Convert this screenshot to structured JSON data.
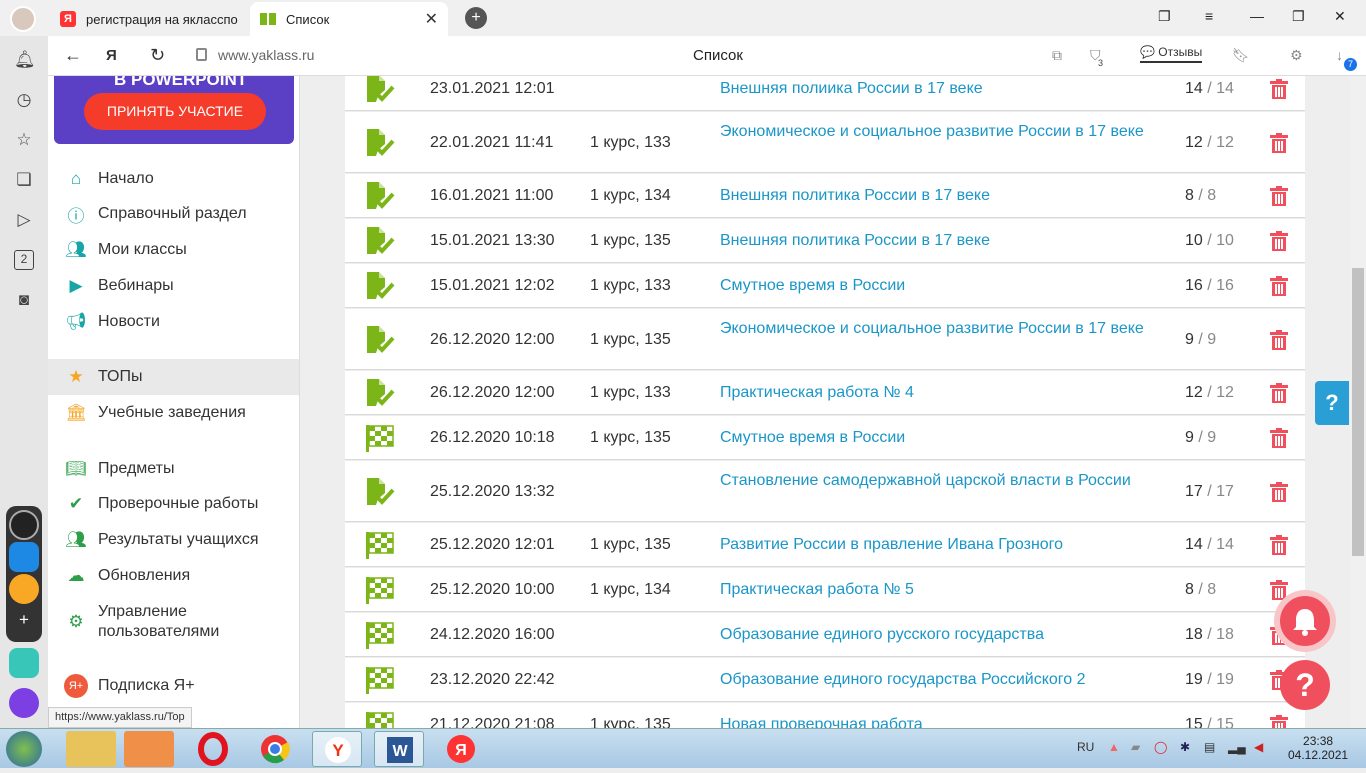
{
  "browser": {
    "tabs": [
      {
        "label": "регистрация на якласспо",
        "favicon": "Я"
      },
      {
        "label": "Список",
        "favicon": "yaklass-icon"
      }
    ],
    "url": "www.yaklass.ru",
    "page_title": "Список",
    "reviews_label": "Отзывы",
    "badge_count": "3",
    "downloads_count": "7",
    "status_url": "https://www.yaklass.ru/Top"
  },
  "sidebar": {
    "promo_title": "В POWERPOINT",
    "promo_button": "ПРИНЯТЬ УЧАСТИЕ",
    "menu": [
      {
        "label": "Начало",
        "icon": "home-icon"
      },
      {
        "label": "Справочный раздел",
        "icon": "help-icon"
      },
      {
        "label": "Мои классы",
        "icon": "people-icon"
      },
      {
        "label": "Вебинары",
        "icon": "play-icon"
      },
      {
        "label": "Новости",
        "icon": "megaphone-icon"
      },
      {
        "label": "ТОПы",
        "icon": "star-icon"
      },
      {
        "label": "Учебные заведения",
        "icon": "institution-icon"
      },
      {
        "label": "Предметы",
        "icon": "book-icon"
      },
      {
        "label": "Проверочные работы",
        "icon": "check-circle-icon"
      },
      {
        "label": "Результаты учащихся",
        "icon": "users-icon"
      },
      {
        "label": "Обновления",
        "icon": "cloud-icon"
      },
      {
        "label": "Управление пользователями",
        "icon": "gear-users-icon"
      },
      {
        "label": "Подписка Я+",
        "icon": "subscription-icon"
      }
    ]
  },
  "rows": [
    {
      "icon": "doc-check",
      "date": "23.01.2021 12:01",
      "class": "",
      "title": "Внешняя полиика России в 17 веке",
      "score": "14",
      "total": "/ 14"
    },
    {
      "icon": "doc-check",
      "date": "22.01.2021 11:41",
      "class": "1 курс, 133",
      "title": "Экономическое и социальное развитие России в 17 веке",
      "score": "12",
      "total": "/ 12"
    },
    {
      "icon": "doc-check",
      "date": "16.01.2021 11:00",
      "class": "1 курс, 134",
      "title": "Внешняя политика России в 17 веке",
      "score": "8",
      "total": "/ 8"
    },
    {
      "icon": "doc-check",
      "date": "15.01.2021 13:30",
      "class": "1 курс, 135",
      "title": "Внешняя политика России в 17 веке",
      "score": "10",
      "total": "/ 10"
    },
    {
      "icon": "doc-check",
      "date": "15.01.2021 12:02",
      "class": "1 курс, 133",
      "title": "Смутное время в России",
      "score": "16",
      "total": "/ 16"
    },
    {
      "icon": "doc-check",
      "date": "26.12.2020 12:00",
      "class": "1 курс, 135",
      "title": "Экономическое и социальное развитие России в 17 веке",
      "score": "9",
      "total": "/ 9"
    },
    {
      "icon": "doc-check",
      "date": "26.12.2020 12:00",
      "class": "1 курс, 133",
      "title": "Практическая работа № 4",
      "score": "12",
      "total": "/ 12"
    },
    {
      "icon": "flag",
      "date": "26.12.2020 10:18",
      "class": "1 курс, 135",
      "title": "Смутное время в России",
      "score": "9",
      "total": "/ 9"
    },
    {
      "icon": "doc-check",
      "date": "25.12.2020 13:32",
      "class": "",
      "title": "Становление самодержавной царской власти в России",
      "score": "17",
      "total": "/ 17"
    },
    {
      "icon": "flag",
      "date": "25.12.2020 12:01",
      "class": "1 курс, 135",
      "title": "Развитие России в правление Ивана Грозного",
      "score": "14",
      "total": "/ 14"
    },
    {
      "icon": "flag",
      "date": "25.12.2020 10:00",
      "class": "1 курс, 134",
      "title": "Практическая работа № 5",
      "score": "8",
      "total": "/ 8"
    },
    {
      "icon": "flag",
      "date": "24.12.2020 16:00",
      "class": "",
      "title": "Образование единого русского государства",
      "score": "18",
      "total": "/ 18"
    },
    {
      "icon": "flag",
      "date": "23.12.2020 22:42",
      "class": "",
      "title": "Образование единого государства Российского 2",
      "score": "19",
      "total": "/ 19"
    },
    {
      "icon": "flag",
      "date": "21.12.2020 21:08",
      "class": "1 курс, 135",
      "title": "Новая проверочная работа",
      "score": "15",
      "total": "/ 15"
    }
  ],
  "help_button": "?",
  "taskbar": {
    "lang": "RU",
    "time": "23:38",
    "date": "04.12.2021"
  },
  "colors": {
    "accent_green": "#7cb518",
    "link_blue": "#1a96c8",
    "delete_red": "#f0505e",
    "promo_purple": "#5b3fc5",
    "promo_button": "#f53b2a",
    "menu_icon_teal": "#17a5a7"
  }
}
